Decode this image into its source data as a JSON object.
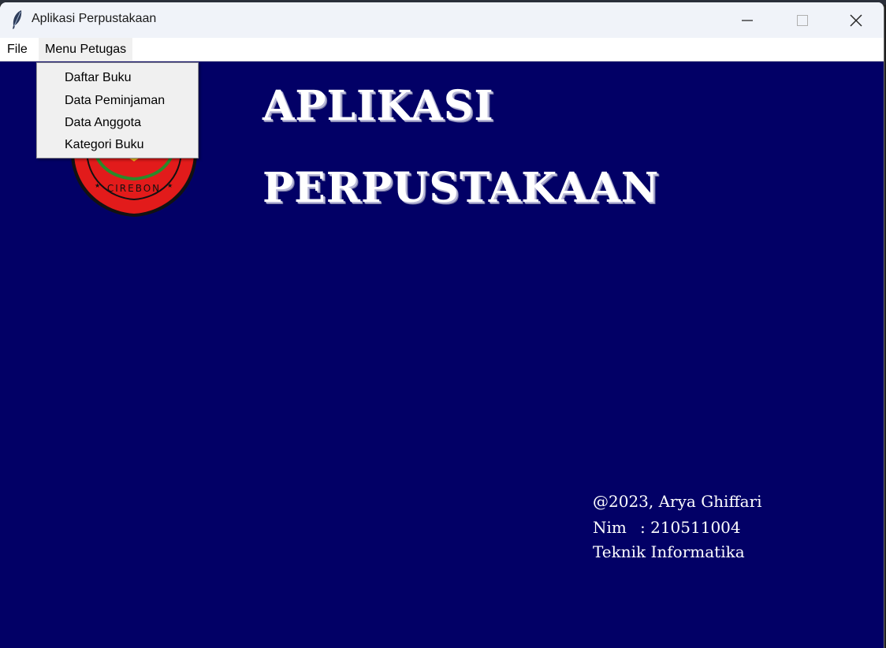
{
  "window": {
    "title": "Aplikasi Perpustakaan",
    "app_icon": "feather-icon"
  },
  "menubar": {
    "file": "File",
    "petugas": "Menu Petugas"
  },
  "dropdown": {
    "items": [
      "Daftar Buku",
      "Data Peminjaman",
      "Data Anggota",
      "Kategori Buku"
    ]
  },
  "heading": {
    "line1": "APLIKASI",
    "line2": "PERPUSTAKAAN"
  },
  "logo": {
    "text": "CIREBON",
    "colors": {
      "outer": "#e21b1b",
      "inner_ring": "#2a8a2a",
      "accent": "#f2c11a"
    }
  },
  "credits": {
    "line1": "@2023, Arya Ghiffari",
    "nim_label": "Nim",
    "nim_value": ": 210511004",
    "line3": "Teknik Informatika"
  },
  "colors": {
    "background": "#020066",
    "text": "#ffffff",
    "menu_bg": "#f0f0f0"
  }
}
